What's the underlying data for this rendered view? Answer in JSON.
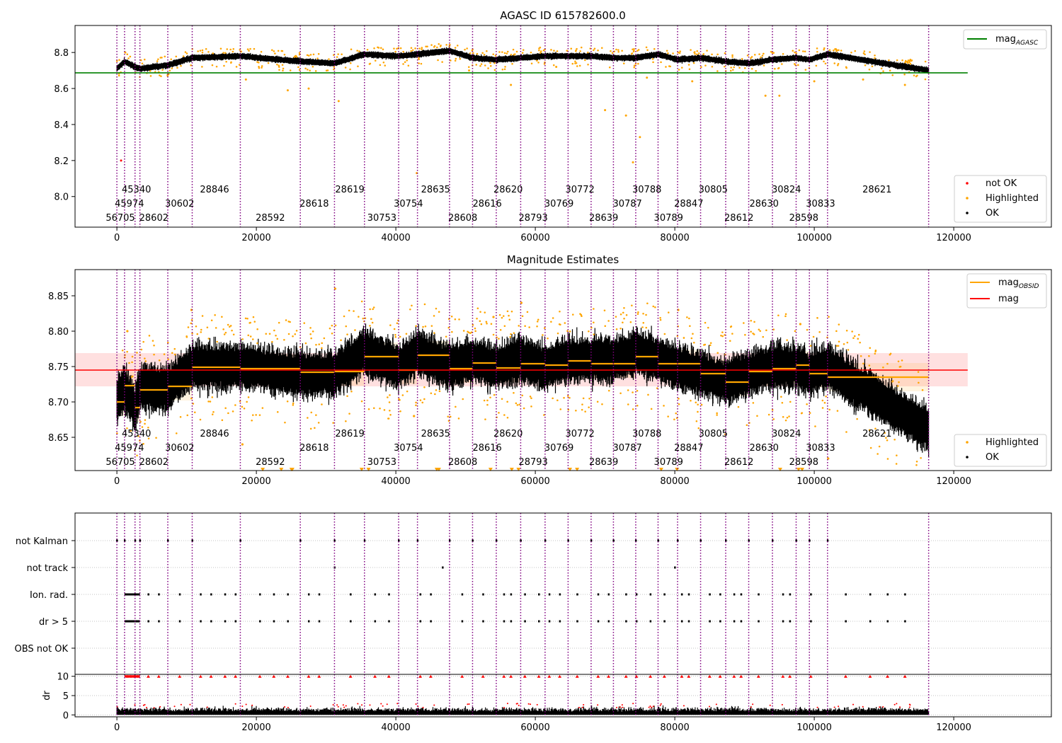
{
  "figure": {
    "top_title": "AGASC ID 615782600.0",
    "middle_title": "Magnitude Estimates"
  },
  "obsids": {
    "times": [
      0,
      1100,
      2600,
      3300,
      7300,
      10800,
      17700,
      26300,
      31200,
      35500,
      40400,
      43100,
      47700,
      51000,
      54400,
      57900,
      61400,
      64700,
      68000,
      71200,
      74400,
      77600,
      80400,
      83700,
      87300,
      90600,
      94000,
      97400,
      99300,
      101900,
      116400
    ],
    "labels": [
      {
        "text": "45340",
        "x": 2800,
        "row": 0
      },
      {
        "text": "28846",
        "x": 14000,
        "row": 0
      },
      {
        "text": "28619",
        "x": 33400,
        "row": 0
      },
      {
        "text": "28635",
        "x": 45700,
        "row": 0
      },
      {
        "text": "28620",
        "x": 56100,
        "row": 0
      },
      {
        "text": "30772",
        "x": 66400,
        "row": 0
      },
      {
        "text": "30788",
        "x": 76000,
        "row": 0
      },
      {
        "text": "30805",
        "x": 85500,
        "row": 0
      },
      {
        "text": "30824",
        "x": 96000,
        "row": 0
      },
      {
        "text": "28621",
        "x": 109000,
        "row": 0
      },
      {
        "text": "45974",
        "x": 1800,
        "row": 1
      },
      {
        "text": "30602",
        "x": 9000,
        "row": 1
      },
      {
        "text": "28618",
        "x": 28300,
        "row": 1
      },
      {
        "text": "30754",
        "x": 41800,
        "row": 1
      },
      {
        "text": "28616",
        "x": 53100,
        "row": 1
      },
      {
        "text": "30769",
        "x": 63400,
        "row": 1
      },
      {
        "text": "30787",
        "x": 73200,
        "row": 1
      },
      {
        "text": "28847",
        "x": 82000,
        "row": 1
      },
      {
        "text": "28630",
        "x": 92800,
        "row": 1
      },
      {
        "text": "30833",
        "x": 100900,
        "row": 1
      },
      {
        "text": "56705",
        "x": 500,
        "row": 2
      },
      {
        "text": "28602",
        "x": 5300,
        "row": 2
      },
      {
        "text": "28592",
        "x": 22000,
        "row": 2
      },
      {
        "text": "30753",
        "x": 38000,
        "row": 2
      },
      {
        "text": "28608",
        "x": 49600,
        "row": 2
      },
      {
        "text": "28793",
        "x": 59700,
        "row": 2
      },
      {
        "text": "28639",
        "x": 69800,
        "row": 2
      },
      {
        "text": "30789",
        "x": 79100,
        "row": 2
      },
      {
        "text": "28612",
        "x": 89200,
        "row": 2
      },
      {
        "text": "28598",
        "x": 98500,
        "row": 2
      }
    ]
  },
  "legends": {
    "top_line": {
      "label": "mag",
      "sub": "AGASC"
    },
    "top_points": [
      "not OK",
      "Highlighted",
      "OK"
    ],
    "mid_lines": [
      {
        "label": "mag",
        "sub": "OBSID"
      },
      {
        "label": "mag",
        "sub": ""
      }
    ],
    "mid_points": [
      "Highlighted",
      "OK"
    ]
  },
  "colors": {
    "ok": "#000000",
    "highlighted": "#ffa500",
    "not_ok": "#ff0000",
    "agasc_line": "#008000",
    "mag_line": "#ff0000",
    "obsid_line": "#ffa500",
    "obsid_line_vertical": "#800080"
  },
  "chart_data": [
    {
      "type": "scatter",
      "title": "AGASC ID 615782600.0",
      "xlabel": "",
      "ylabel": "",
      "xlim": [
        -6000,
        134000
      ],
      "ylim": [
        7.83,
        8.95
      ],
      "x_ticks": [
        "0",
        "20000",
        "40000",
        "60000",
        "80000",
        "100000",
        "120000"
      ],
      "y_ticks": [
        "8.0",
        "8.2",
        "8.4",
        "8.6",
        "8.8"
      ],
      "mag_agasc": 8.687,
      "agasc_line_x": [
        -6000,
        122000
      ],
      "series": [
        {
          "name": "OK",
          "color": "black",
          "x": [
            0,
            1100,
            2600,
            3300,
            7300,
            10800,
            17700,
            26300,
            31200,
            35500,
            40400,
            43100,
            47700,
            51000,
            54400,
            57900,
            61400,
            64700,
            68000,
            71200,
            74400,
            77600,
            80400,
            83700,
            87300,
            90600,
            94000,
            97400,
            99300,
            101900,
            116400
          ],
          "y": [
            8.71,
            8.75,
            8.72,
            8.71,
            8.73,
            8.77,
            8.78,
            8.75,
            8.74,
            8.79,
            8.78,
            8.79,
            8.81,
            8.77,
            8.76,
            8.77,
            8.78,
            8.78,
            8.78,
            8.77,
            8.77,
            8.79,
            8.76,
            8.77,
            8.75,
            8.74,
            8.76,
            8.77,
            8.76,
            8.79,
            8.7
          ]
        },
        {
          "name": "Highlighted",
          "color": "orange",
          "x": [
            1200,
            6000,
            18500,
            24500,
            27500,
            31800,
            43000,
            50500,
            56500,
            63000,
            70000,
            73000,
            74000,
            75000,
            76000,
            82500,
            93000,
            95000,
            100000,
            107000,
            113000
          ],
          "y": [
            8.8,
            8.69,
            8.65,
            8.59,
            8.6,
            8.53,
            8.13,
            8.7,
            8.62,
            8.72,
            8.48,
            8.45,
            8.19,
            8.33,
            8.66,
            8.64,
            8.56,
            8.56,
            8.64,
            8.65,
            8.62
          ]
        },
        {
          "name": "not OK",
          "color": "red",
          "x": [
            600
          ],
          "y": [
            8.2
          ]
        }
      ]
    },
    {
      "type": "scatter",
      "title": "Magnitude Estimates",
      "xlim": [
        -6000,
        134000
      ],
      "ylim": [
        8.603,
        8.887
      ],
      "x_ticks": [
        "0",
        "20000",
        "40000",
        "60000",
        "80000",
        "100000",
        "120000"
      ],
      "y_ticks": [
        "8.65",
        "8.70",
        "8.75",
        "8.80",
        "8.85"
      ],
      "mag": 8.745,
      "mag_band": [
        8.722,
        8.769
      ],
      "mag_line_x": [
        -6000,
        122000
      ],
      "mag_obsid": [
        8.7,
        8.723,
        8.692,
        8.717,
        8.722,
        8.749,
        8.747,
        8.742,
        8.743,
        8.764,
        8.745,
        8.766,
        8.747,
        8.755,
        8.748,
        8.754,
        8.752,
        8.758,
        8.754,
        8.754,
        8.764,
        8.754,
        8.754,
        8.74,
        8.728,
        8.743,
        8.747,
        8.752,
        8.74,
        8.735
      ],
      "series": [
        {
          "name": "OK",
          "color": "black",
          "x": [
            0,
            1100,
            2600,
            3300,
            7300,
            10800,
            17700,
            26300,
            31200,
            35500,
            40400,
            43100,
            47700,
            51000,
            54400,
            57900,
            61400,
            64700,
            68000,
            71200,
            74400,
            77600,
            80400,
            83700,
            87300,
            90600,
            94000,
            97400,
            99300,
            101900,
            116400
          ],
          "y": [
            8.7,
            8.72,
            8.69,
            8.72,
            8.72,
            8.75,
            8.75,
            8.74,
            8.74,
            8.77,
            8.75,
            8.77,
            8.75,
            8.76,
            8.75,
            8.76,
            8.75,
            8.76,
            8.76,
            8.76,
            8.77,
            8.76,
            8.75,
            8.74,
            8.73,
            8.74,
            8.75,
            8.75,
            8.74,
            8.75,
            8.66
          ]
        },
        {
          "name": "Highlighted",
          "color": "orange",
          "x": [
            1500,
            10700,
            18000,
            31300,
            42600,
            54000,
            58000,
            80500,
            98000,
            102000
          ],
          "y": [
            8.8,
            8.83,
            8.64,
            8.86,
            8.68,
            8.82,
            8.84,
            8.83,
            8.81,
            8.62
          ]
        }
      ]
    },
    {
      "type": "scatter",
      "title": "",
      "xlim": [
        -6000,
        134000
      ],
      "flag_rows": [
        "not Kalman",
        "not track",
        "Ion. rad.",
        "dr > 5",
        "OBS not OK"
      ],
      "series": [
        {
          "name": "not Kalman",
          "x": [
            0,
            1100,
            2600,
            3300,
            7300,
            10800,
            17700,
            26300,
            31200,
            35500,
            40400,
            43100,
            47700,
            51000,
            54400,
            57900,
            61400,
            64700,
            68000,
            71200,
            74400,
            77600,
            80400,
            83700,
            87300,
            90600,
            94000,
            97400,
            99300,
            101900
          ]
        },
        {
          "name": "not track",
          "x": [
            31200,
            46700,
            80000
          ]
        },
        {
          "name": "Ion. rad.",
          "x": [
            1500,
            2000,
            2500,
            3000,
            4500,
            6000,
            9000,
            12000,
            13500,
            15500,
            17000,
            20500,
            22500,
            24500,
            27500,
            29000,
            33500,
            37000,
            39000,
            43500,
            45000,
            49500,
            52500,
            55500,
            56500,
            58500,
            60500,
            62000,
            63500,
            66000,
            69000,
            70500,
            73000,
            74500,
            76500,
            78500,
            81000,
            82000,
            85000,
            86500,
            88500,
            89500,
            92000,
            95500,
            96500,
            99500,
            104500,
            108000,
            110500,
            113000
          ]
        },
        {
          "name": "dr > 5",
          "x": [
            1500,
            2000,
            2500,
            3000,
            4500,
            6000,
            9000,
            12000,
            13500,
            15500,
            17000,
            20500,
            22500,
            24500,
            27500,
            29000,
            33500,
            37000,
            39000,
            43500,
            45000,
            49500,
            52500,
            55500,
            56500,
            58500,
            60500,
            62000,
            63500,
            66000,
            69000,
            70500,
            73000,
            74500,
            76500,
            78500,
            81000,
            82000,
            85000,
            86500,
            88500,
            89500,
            92000,
            95500,
            96500,
            99500,
            104500,
            108000,
            110500,
            113000
          ]
        },
        {
          "name": "OBS not OK",
          "x": []
        }
      ]
    },
    {
      "type": "scatter",
      "title": "",
      "xlabel": "",
      "ylabel": "dr",
      "xlim": [
        -6000,
        134000
      ],
      "ylim": [
        -0.5,
        10.5
      ],
      "x_ticks": [
        "0",
        "20000",
        "40000",
        "60000",
        "80000",
        "100000",
        "120000"
      ],
      "y_ticks": [
        "0",
        "5",
        "10"
      ],
      "series": [
        {
          "name": "dr",
          "color": "black",
          "x": [
            0,
            116400
          ],
          "y": [
            1,
            1
          ]
        },
        {
          "name": "dr > 5",
          "color": "red",
          "x": [
            1500,
            2000,
            2500,
            3000,
            4500,
            6000,
            9000,
            12000,
            13500,
            15500,
            17000,
            20500,
            22500,
            24500,
            27500,
            29000,
            33500,
            37000,
            39000,
            43500,
            45000,
            49500,
            52500,
            55500,
            56500,
            58500,
            60500,
            62000,
            63500,
            66000,
            69000,
            70500,
            73000,
            74500,
            76500,
            78500,
            81000,
            82000,
            85000,
            86500,
            88500,
            89500,
            92000,
            95500,
            96500,
            99500,
            104500,
            108000,
            110500,
            113000
          ],
          "y": [
            10,
            10,
            10,
            10,
            10,
            10,
            10,
            10,
            10,
            10,
            10,
            10,
            10,
            10,
            10,
            10,
            10,
            10,
            10,
            10,
            10,
            10,
            10,
            10,
            10,
            10,
            10,
            10,
            10,
            10,
            10,
            10,
            10,
            10,
            10,
            10,
            10,
            10,
            10,
            10,
            10,
            10,
            10,
            10,
            10,
            10,
            10,
            10,
            10,
            10
          ]
        }
      ]
    }
  ]
}
